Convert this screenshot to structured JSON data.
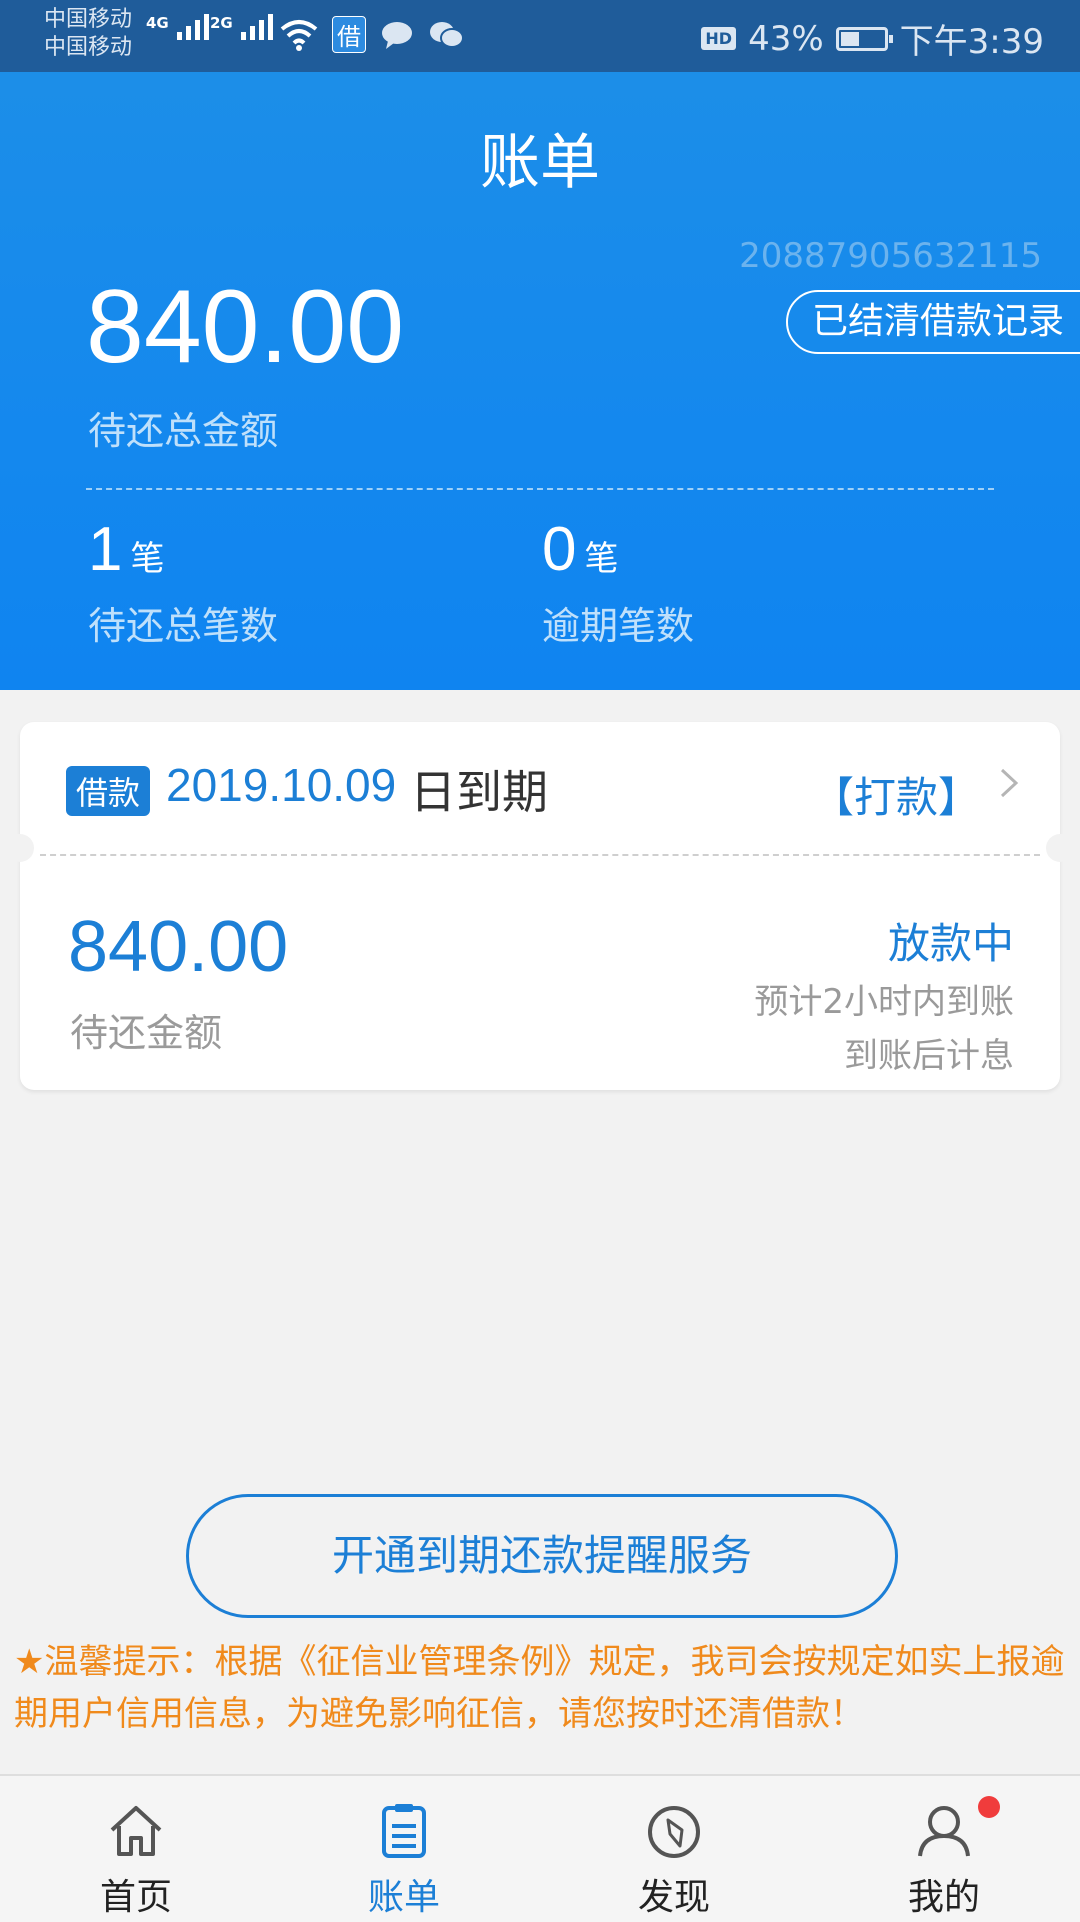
{
  "status_bar": {
    "carrier_1": "中国移动",
    "carrier_2": "中国移动",
    "network_1": "4G",
    "network_2": "2G",
    "app_icon_text": "借",
    "hd": "HD",
    "battery": "43%",
    "time": "下午3:39"
  },
  "header": {
    "title": "账单",
    "account_number": "20887905632115",
    "settled_button": "已结清借款记录",
    "total_amount": "840.00",
    "total_label": "待还总金额",
    "pending_count": "1",
    "pending_unit": "笔",
    "pending_label": "待还总笔数",
    "overdue_count": "0",
    "overdue_unit": "笔",
    "overdue_label": "逾期笔数"
  },
  "loan_card": {
    "tag": "借款",
    "due_date": "2019.10.09",
    "due_suffix": "日到期",
    "action": "【打款】",
    "amount": "840.00",
    "amount_label": "待还金额",
    "status": "放款中",
    "note_1": "预计2小时内到账",
    "note_2": "到账后计息"
  },
  "reminder_button": "开通到期还款提醒服务",
  "tip": "★温馨提示：根据《征信业管理条例》规定，我司会按规定如实上报逾期用户信用信息，为避免影响征信，请您按时还清借款！",
  "nav": {
    "items": [
      {
        "label": "首页",
        "icon": "home-icon"
      },
      {
        "label": "账单",
        "icon": "bill-icon"
      },
      {
        "label": "发现",
        "icon": "compass-icon"
      },
      {
        "label": "我的",
        "icon": "user-icon"
      }
    ],
    "active": "账单"
  },
  "colors": {
    "primary": "#1c7fd6",
    "header": "#1488ee",
    "status_bar": "#1f5c9a",
    "tip": "#f08a1c",
    "badge": "#f03c3c"
  }
}
